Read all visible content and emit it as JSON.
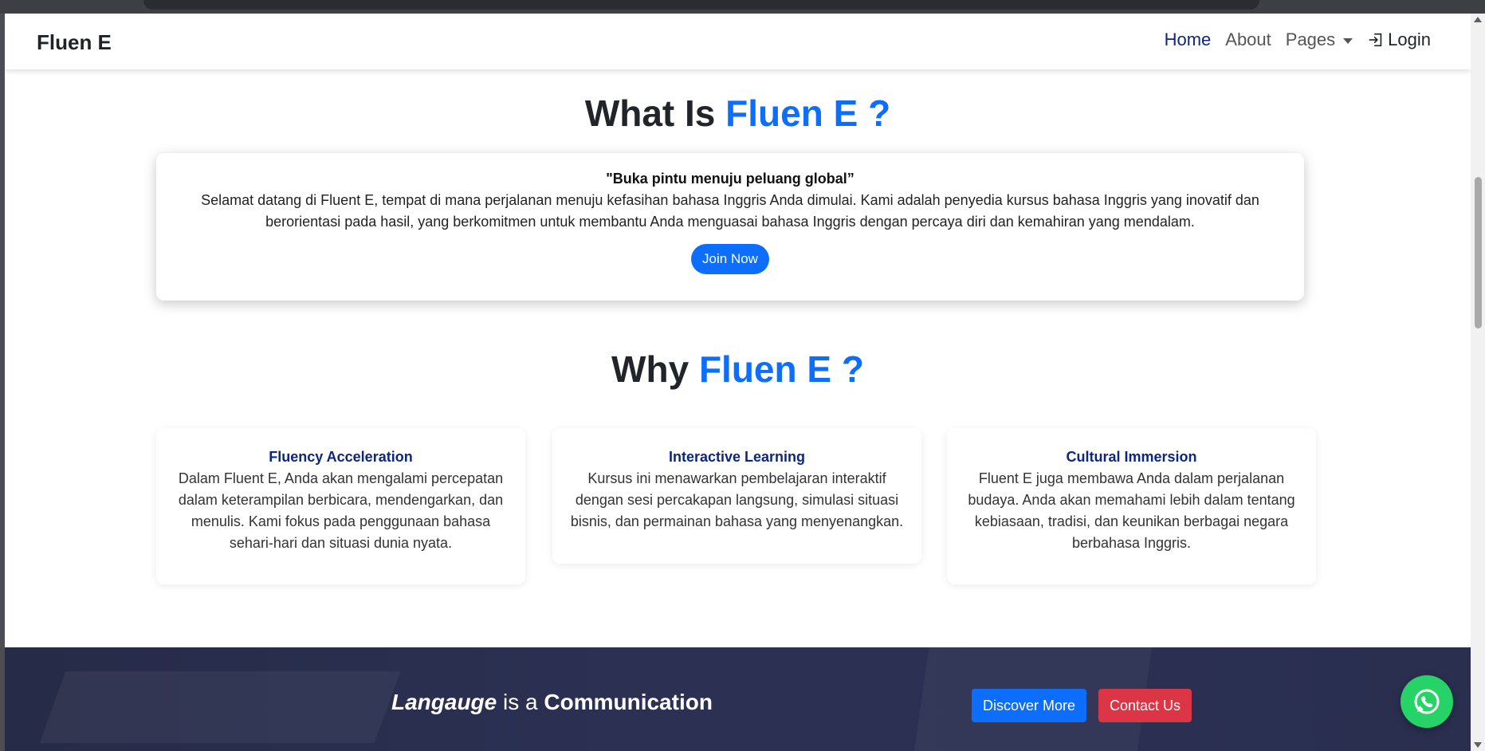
{
  "navbar": {
    "brand": "Fluen E",
    "links": {
      "home": "Home",
      "about": "About",
      "pages": "Pages",
      "login": "Login"
    }
  },
  "what_section": {
    "title_prefix": "What Is",
    "title_accent": "Fluen E ?",
    "quote": "\"Buka pintu menuju peluang global”",
    "text": "Selamat datang di Fluent E, tempat di mana perjalanan menuju kefasihan bahasa Inggris Anda dimulai. Kami adalah penyedia kursus bahasa Inggris yang inovatif dan berorientasi pada hasil, yang berkomitmen untuk membantu Anda menguasai bahasa Inggris dengan percaya diri dan kemahiran yang mendalam.",
    "button": "Join Now"
  },
  "why_section": {
    "title_prefix": "Why",
    "title_accent": "Fluen E ?",
    "cards": [
      {
        "title": "Fluency Acceleration",
        "text": "Dalam Fluent E, Anda akan mengalami percepatan dalam keterampilan berbicara, mendengarkan, dan menulis. Kami fokus pada penggunaan bahasa sehari-hari dan situasi dunia nyata."
      },
      {
        "title": "Interactive Learning",
        "text": "Kursus ini menawarkan pembelajaran interaktif dengan sesi percakapan langsung, simulasi situasi bisnis, dan permainan bahasa yang menyenangkan."
      },
      {
        "title": "Cultural Immersion",
        "text": "Fluent E juga membawa Anda dalam perjalanan budaya. Anda akan memahami lebih dalam tentang kebiasaan, tradisi, dan keunikan berbagai negara berbahasa Inggris."
      }
    ]
  },
  "banner": {
    "word1": "Langauge",
    "word2": " is a ",
    "word3": "Communication",
    "discover": "Discover More",
    "contact": "Contact Us"
  },
  "icons": {
    "login": "login-icon",
    "whatsapp": "whatsapp-icon"
  },
  "colors": {
    "accent": "#0d6efd",
    "nav_active": "#0d2680",
    "danger": "#dc3545",
    "whatsapp": "#25d366",
    "banner_bg": "#2a2f50"
  }
}
